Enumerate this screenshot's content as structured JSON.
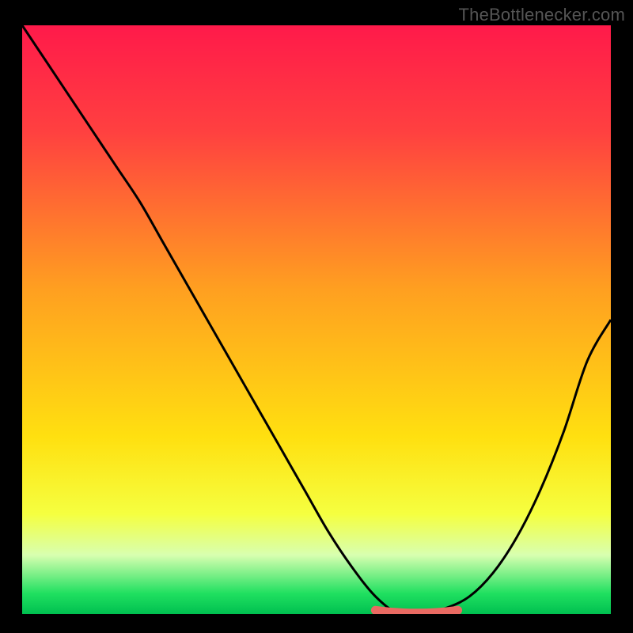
{
  "attribution": "TheBottlenecker.com",
  "chart_data": {
    "type": "line",
    "title": "",
    "xlabel": "",
    "ylabel": "",
    "xlim": [
      0,
      100
    ],
    "ylim": [
      0,
      100
    ],
    "x": [
      0,
      4,
      8,
      12,
      16,
      20,
      24,
      28,
      32,
      36,
      40,
      44,
      48,
      52,
      56,
      60,
      64,
      68,
      72,
      76,
      80,
      84,
      88,
      92,
      96,
      100
    ],
    "values": [
      100,
      94,
      88,
      82,
      76,
      70,
      63,
      56,
      49,
      42,
      35,
      28,
      21,
      14,
      8,
      3,
      0,
      0,
      1,
      3,
      7,
      13,
      21,
      31,
      43,
      50
    ],
    "gradient_stops": [
      {
        "offset": 0.0,
        "color": "#ff1a4a"
      },
      {
        "offset": 0.18,
        "color": "#ff4040"
      },
      {
        "offset": 0.45,
        "color": "#ffa020"
      },
      {
        "offset": 0.7,
        "color": "#ffe010"
      },
      {
        "offset": 0.83,
        "color": "#f5ff40"
      },
      {
        "offset": 0.9,
        "color": "#d8ffb0"
      },
      {
        "offset": 0.965,
        "color": "#20e060"
      },
      {
        "offset": 1.0,
        "color": "#00c050"
      }
    ],
    "marker": {
      "x_start": 60,
      "x_end": 74,
      "y": 0.5,
      "color": "#e96a62"
    }
  }
}
